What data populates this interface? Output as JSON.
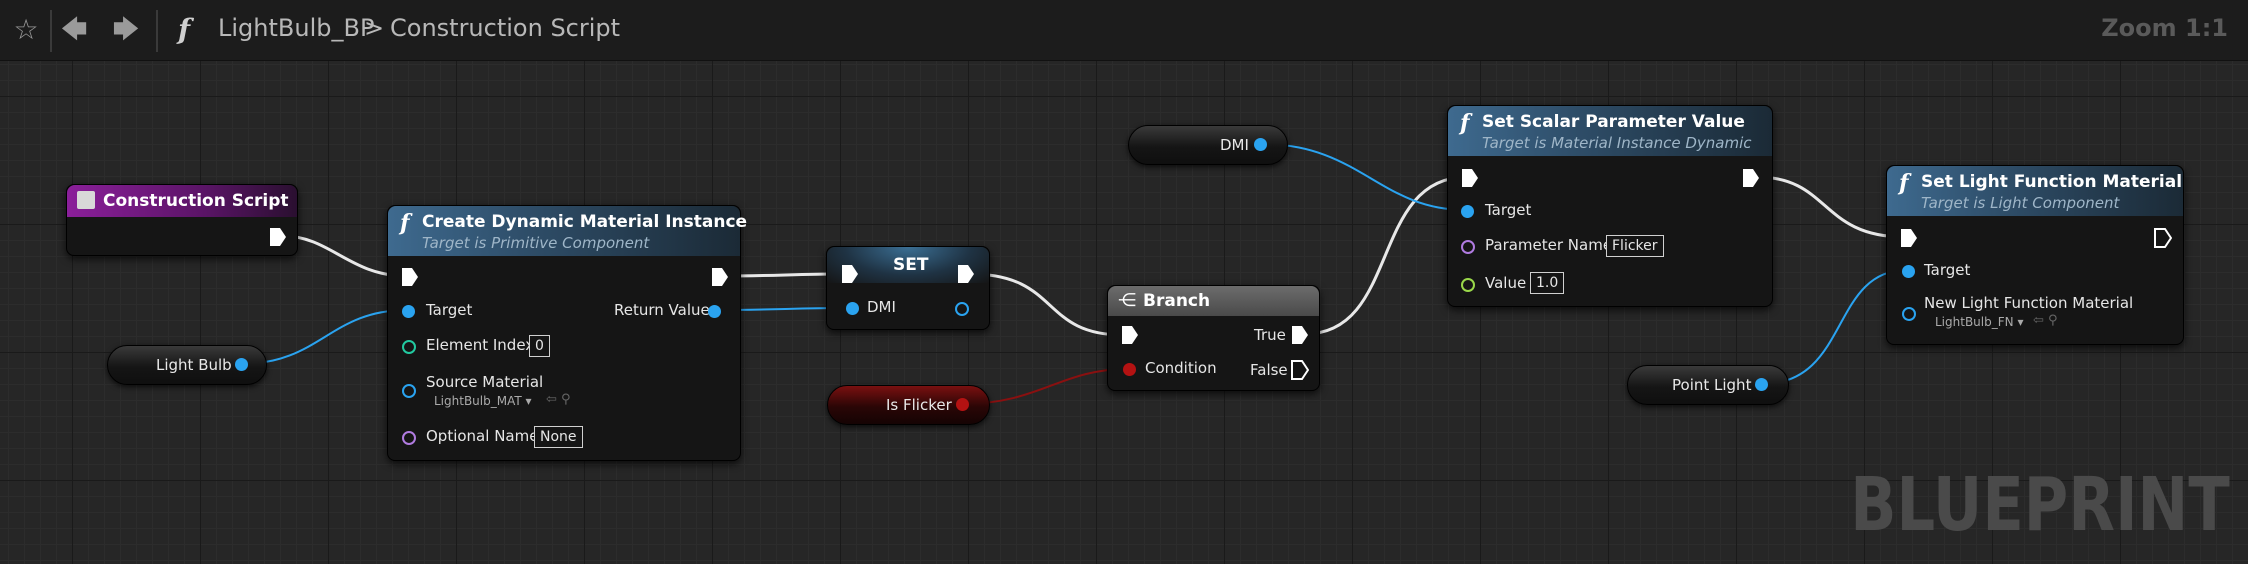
{
  "toolbar": {
    "breadcrumb_blueprint": "LightBulb_BP",
    "breadcrumb_separator": ">",
    "breadcrumb_graph": "Construction Script",
    "zoom": "Zoom 1:1"
  },
  "watermark": "BLUEPRINT",
  "nodes": {
    "construction_script": {
      "title": "Construction Script"
    },
    "create_dmi": {
      "title": "Create Dynamic Material Instance",
      "subtitle": "Target is Primitive Component",
      "target_label": "Target",
      "return_label": "Return Value",
      "element_index_label": "Element Index",
      "element_index_value": "0",
      "source_material_label": "Source Material",
      "source_material_value": "LightBulb_MAT",
      "optional_name_label": "Optional Name",
      "optional_name_value": "None"
    },
    "set": {
      "title": "SET",
      "dmi_label": "DMI"
    },
    "branch": {
      "title": "Branch",
      "true_label": "True",
      "false_label": "False",
      "condition_label": "Condition"
    },
    "set_scalar": {
      "title": "Set Scalar Parameter Value",
      "subtitle": "Target is Material Instance Dynamic",
      "target_label": "Target",
      "param_name_label": "Parameter Name",
      "param_name_value": "Flicker",
      "value_label": "Value",
      "value_value": "1.0"
    },
    "set_light_fn": {
      "title": "Set Light Function Material",
      "subtitle": "Target is Light Component",
      "target_label": "Target",
      "new_material_label": "New Light Function Material",
      "new_material_value": "LightBulb_FN"
    }
  },
  "variables": {
    "light_bulb": "Light Bulb",
    "dmi": "DMI",
    "is_flicker": "Is Flicker",
    "point_light": "Point Light"
  },
  "colors": {
    "object_pin": "#2aa3f0",
    "bool_pin": "#b41212",
    "function_header": "#3e6a8f",
    "event_header": "#8b1f9a"
  }
}
